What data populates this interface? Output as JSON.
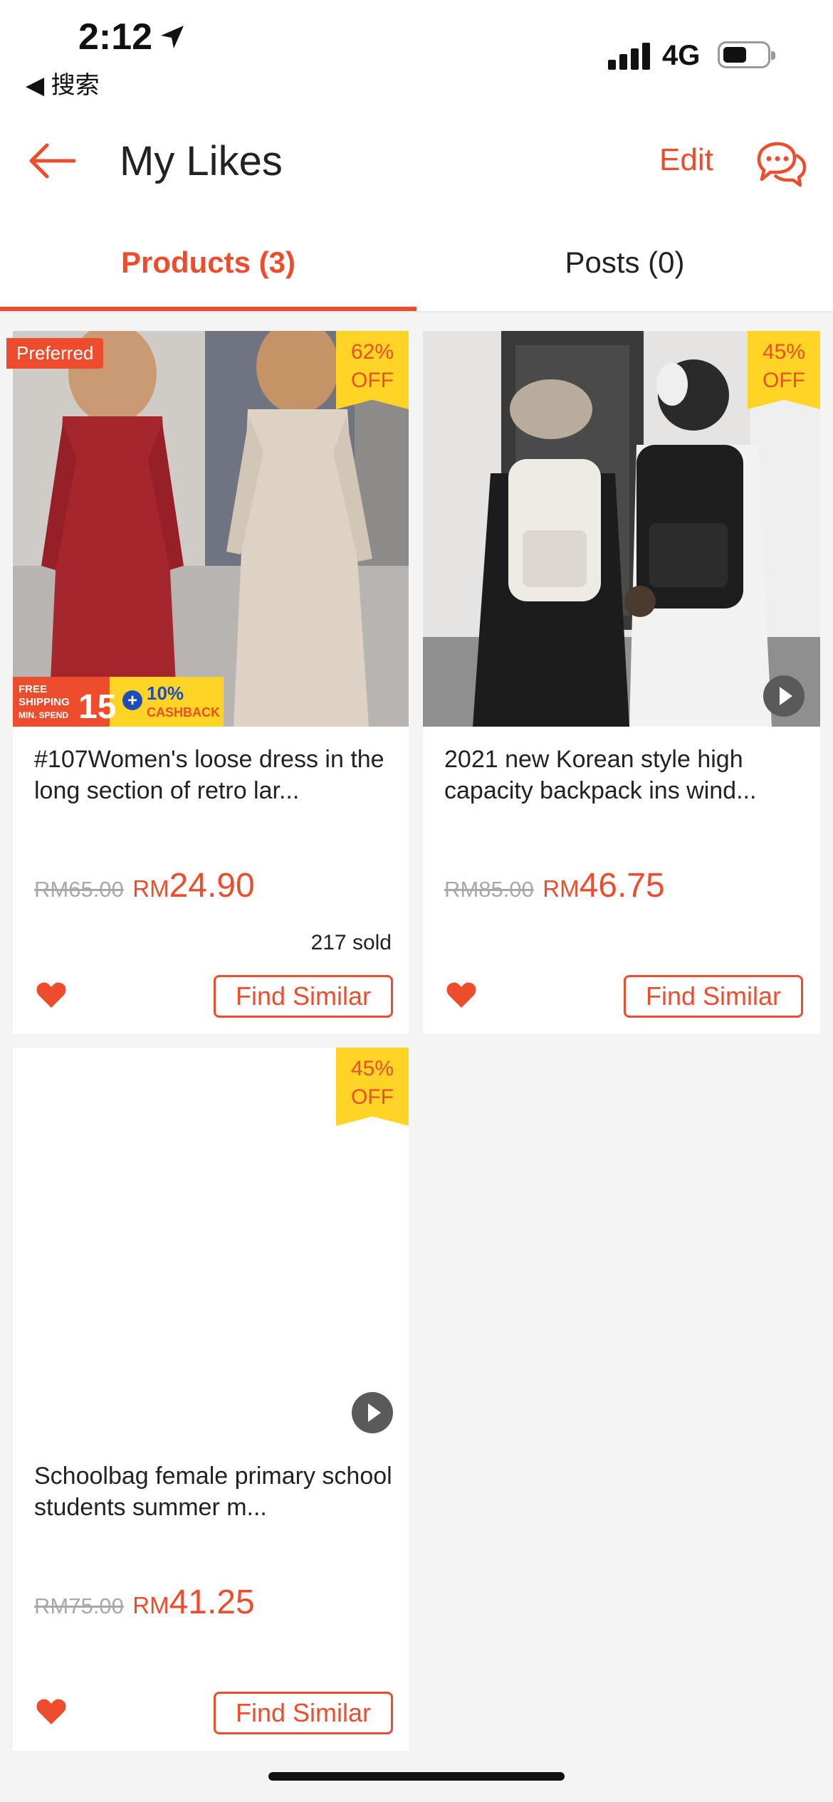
{
  "status_bar": {
    "time": "2:12",
    "back_app": "◀ 搜索",
    "network": "4G"
  },
  "header": {
    "title": "My Likes",
    "edit_label": "Edit"
  },
  "tabs": [
    {
      "label": "Products (3)",
      "active": true
    },
    {
      "label": "Posts (0)",
      "active": false
    }
  ],
  "products": [
    {
      "title": "#107Women's loose dress in the long section of retro lar...",
      "old_price": "RM65.00",
      "currency": "RM",
      "price": "24.90",
      "sold": "217 sold",
      "discount_pct": "62%",
      "discount_off": "OFF",
      "badge": "Preferred",
      "promo": {
        "free": "FREE",
        "shipping": "SHIPPING",
        "min": "MIN. SPEND",
        "amount": "15",
        "cashback_pct": "10%",
        "cashback": "CASHBACK"
      },
      "find_similar": "Find Similar",
      "liked": true
    },
    {
      "title": "2021 new Korean style high capacity backpack ins wind...",
      "old_price": "RM85.00",
      "currency": "RM",
      "price": "46.75",
      "discount_pct": "45%",
      "discount_off": "OFF",
      "find_similar": "Find Similar",
      "liked": true
    },
    {
      "title": "Schoolbag female primary school students summer m...",
      "old_price": "RM75.00",
      "currency": "RM",
      "price": "41.25",
      "discount_pct": "45%",
      "discount_off": "OFF",
      "find_similar": "Find Similar",
      "liked": true
    }
  ],
  "colors": {
    "brand": "#ee4d2d",
    "discount_bg": "#ffd424",
    "page_bg": "#f4f4f4"
  },
  "icons": [
    "location-arrow-icon",
    "signal-icon",
    "battery-icon",
    "back-arrow-icon",
    "chat-icon",
    "heart-icon",
    "play-icon"
  ]
}
